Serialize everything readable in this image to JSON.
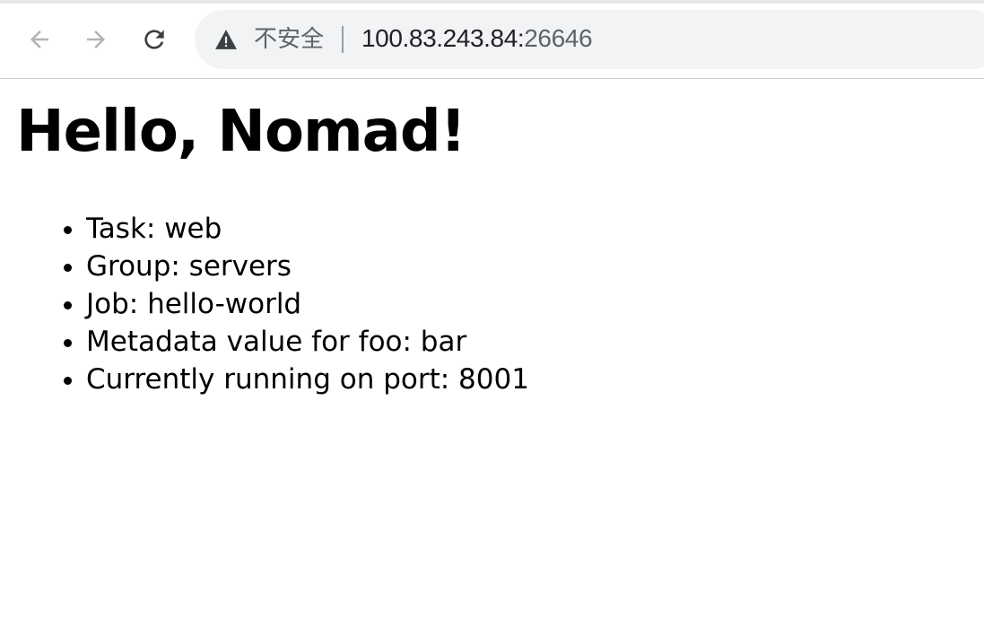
{
  "browser": {
    "security_label": "不安全",
    "url_host": "100.83.243.84:",
    "url_port": "26646",
    "icons": {
      "back": "arrow-left-icon",
      "forward": "arrow-right-icon",
      "reload": "reload-icon",
      "security": "warning-triangle-icon"
    }
  },
  "page": {
    "title": "Hello, Nomad!",
    "items": [
      "Task: web",
      "Group: servers",
      "Job: hello-world",
      "Metadata value for foo: bar",
      "Currently running on port: 8001"
    ]
  }
}
